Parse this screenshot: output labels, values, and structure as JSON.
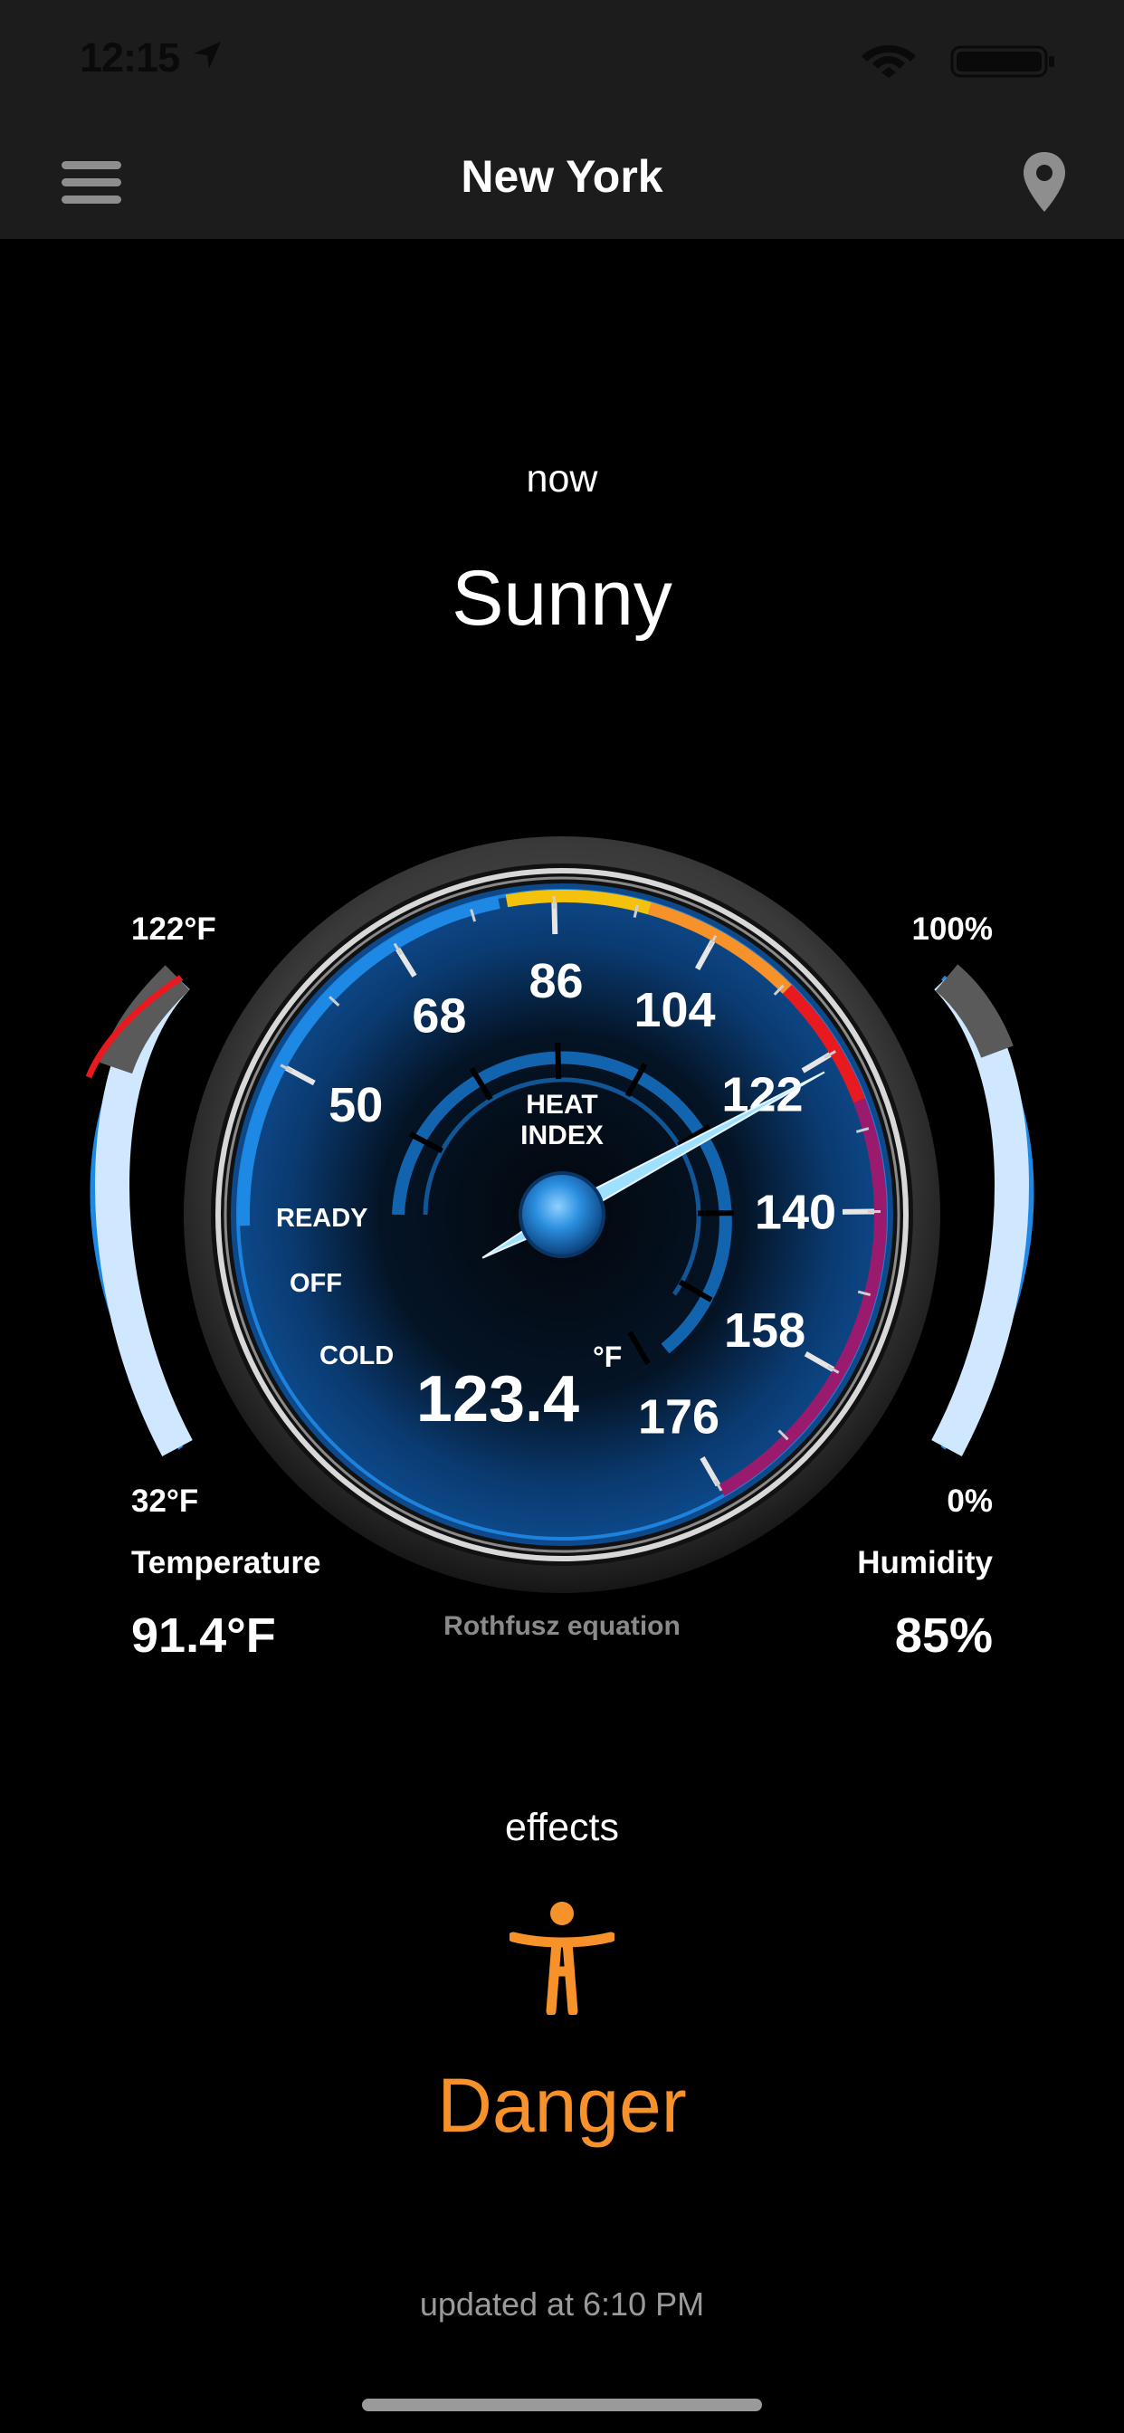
{
  "status_bar": {
    "time": "12:15",
    "icons": [
      "location-arrow-icon",
      "wifi-icon",
      "battery-icon"
    ]
  },
  "nav": {
    "title": "New York",
    "left_icon": "hamburger-menu-icon",
    "right_icon": "map-pin-icon"
  },
  "current": {
    "time_label": "now",
    "condition": "Sunny"
  },
  "gauge": {
    "title_line1": "HEAT",
    "title_line2": "INDEX",
    "ticks": [
      "50",
      "68",
      "86",
      "104",
      "122",
      "140",
      "158",
      "176"
    ],
    "state_labels": [
      "READY",
      "OFF",
      "COLD"
    ],
    "value": "123.4",
    "unit": "°F",
    "needle_value": 123.4,
    "footnote": "Rothfusz equation"
  },
  "temperature": {
    "max_label": "122°F",
    "min_label": "32°F",
    "label": "Temperature",
    "value": "91.4°F",
    "fill_fraction": 0.66
  },
  "humidity": {
    "max_label": "100%",
    "min_label": "0%",
    "label": "Humidity",
    "value": "85%",
    "fill_fraction": 0.85
  },
  "effects": {
    "label": "effects",
    "icon": "person-figure-icon",
    "level": "Danger",
    "level_color": "#f7912a"
  },
  "updated": "updated at 6:10 PM",
  "colors": {
    "background": "#000000",
    "bar": "#1c1c1c",
    "accent_blue": "#1e88e5",
    "danger_orange": "#f7912a",
    "zone_red": "#e8191f",
    "zone_purple": "#9a1b6e",
    "zone_yellow": "#f4c20d"
  }
}
